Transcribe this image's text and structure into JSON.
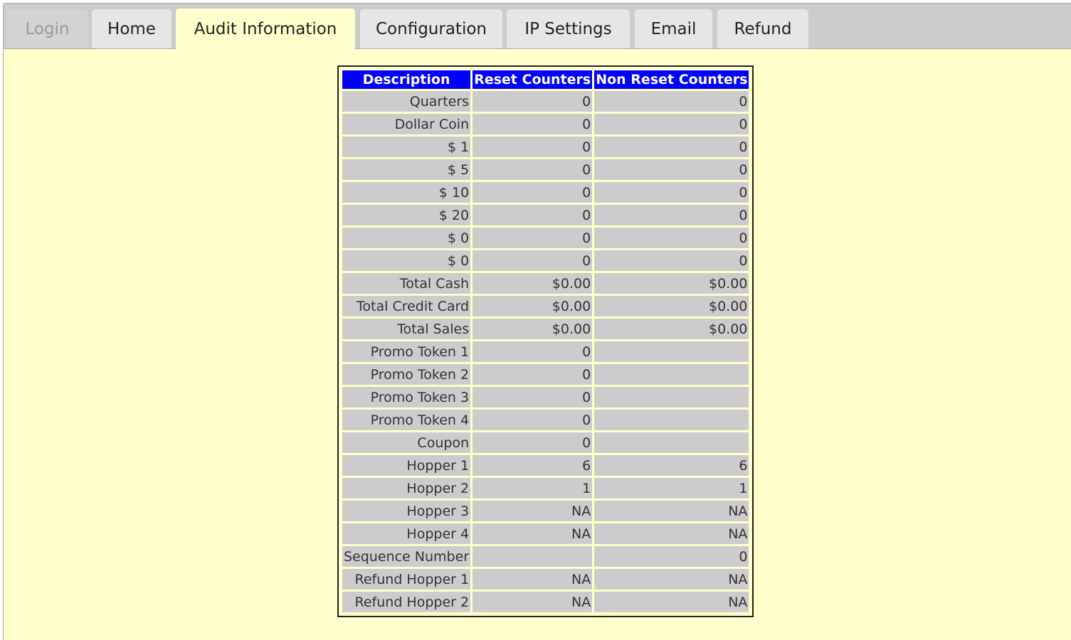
{
  "tabs": [
    {
      "label": "Login",
      "state": "disabled"
    },
    {
      "label": "Home",
      "state": "normal"
    },
    {
      "label": "Audit Information",
      "state": "active"
    },
    {
      "label": "Configuration",
      "state": "normal"
    },
    {
      "label": "IP Settings",
      "state": "normal"
    },
    {
      "label": "Email",
      "state": "normal"
    },
    {
      "label": "Refund",
      "state": "normal"
    }
  ],
  "audit_table": {
    "columns": [
      "Description",
      "Reset Counters",
      "Non Reset Counters"
    ],
    "rows": [
      [
        "Quarters",
        "0",
        "0"
      ],
      [
        "Dollar Coin",
        "0",
        "0"
      ],
      [
        "$ 1",
        "0",
        "0"
      ],
      [
        "$ 5",
        "0",
        "0"
      ],
      [
        "$ 10",
        "0",
        "0"
      ],
      [
        "$ 20",
        "0",
        "0"
      ],
      [
        "$ 0",
        "0",
        "0"
      ],
      [
        "$ 0",
        "0",
        "0"
      ],
      [
        "Total Cash",
        "$0.00",
        "$0.00"
      ],
      [
        "Total Credit Card",
        "$0.00",
        "$0.00"
      ],
      [
        "Total Sales",
        "$0.00",
        "$0.00"
      ],
      [
        "Promo Token 1",
        "0",
        ""
      ],
      [
        "Promo Token 2",
        "0",
        ""
      ],
      [
        "Promo Token 3",
        "0",
        ""
      ],
      [
        "Promo Token 4",
        "0",
        ""
      ],
      [
        "Coupon",
        "0",
        ""
      ],
      [
        "Hopper 1",
        "6",
        "6"
      ],
      [
        "Hopper 2",
        "1",
        "1"
      ],
      [
        "Hopper 3",
        "NA",
        "NA"
      ],
      [
        "Hopper 4",
        "NA",
        "NA"
      ],
      [
        "Sequence Number",
        "",
        "0"
      ],
      [
        "Refund Hopper 1",
        "NA",
        "NA"
      ],
      [
        "Refund Hopper 2",
        "NA",
        "NA"
      ]
    ]
  }
}
